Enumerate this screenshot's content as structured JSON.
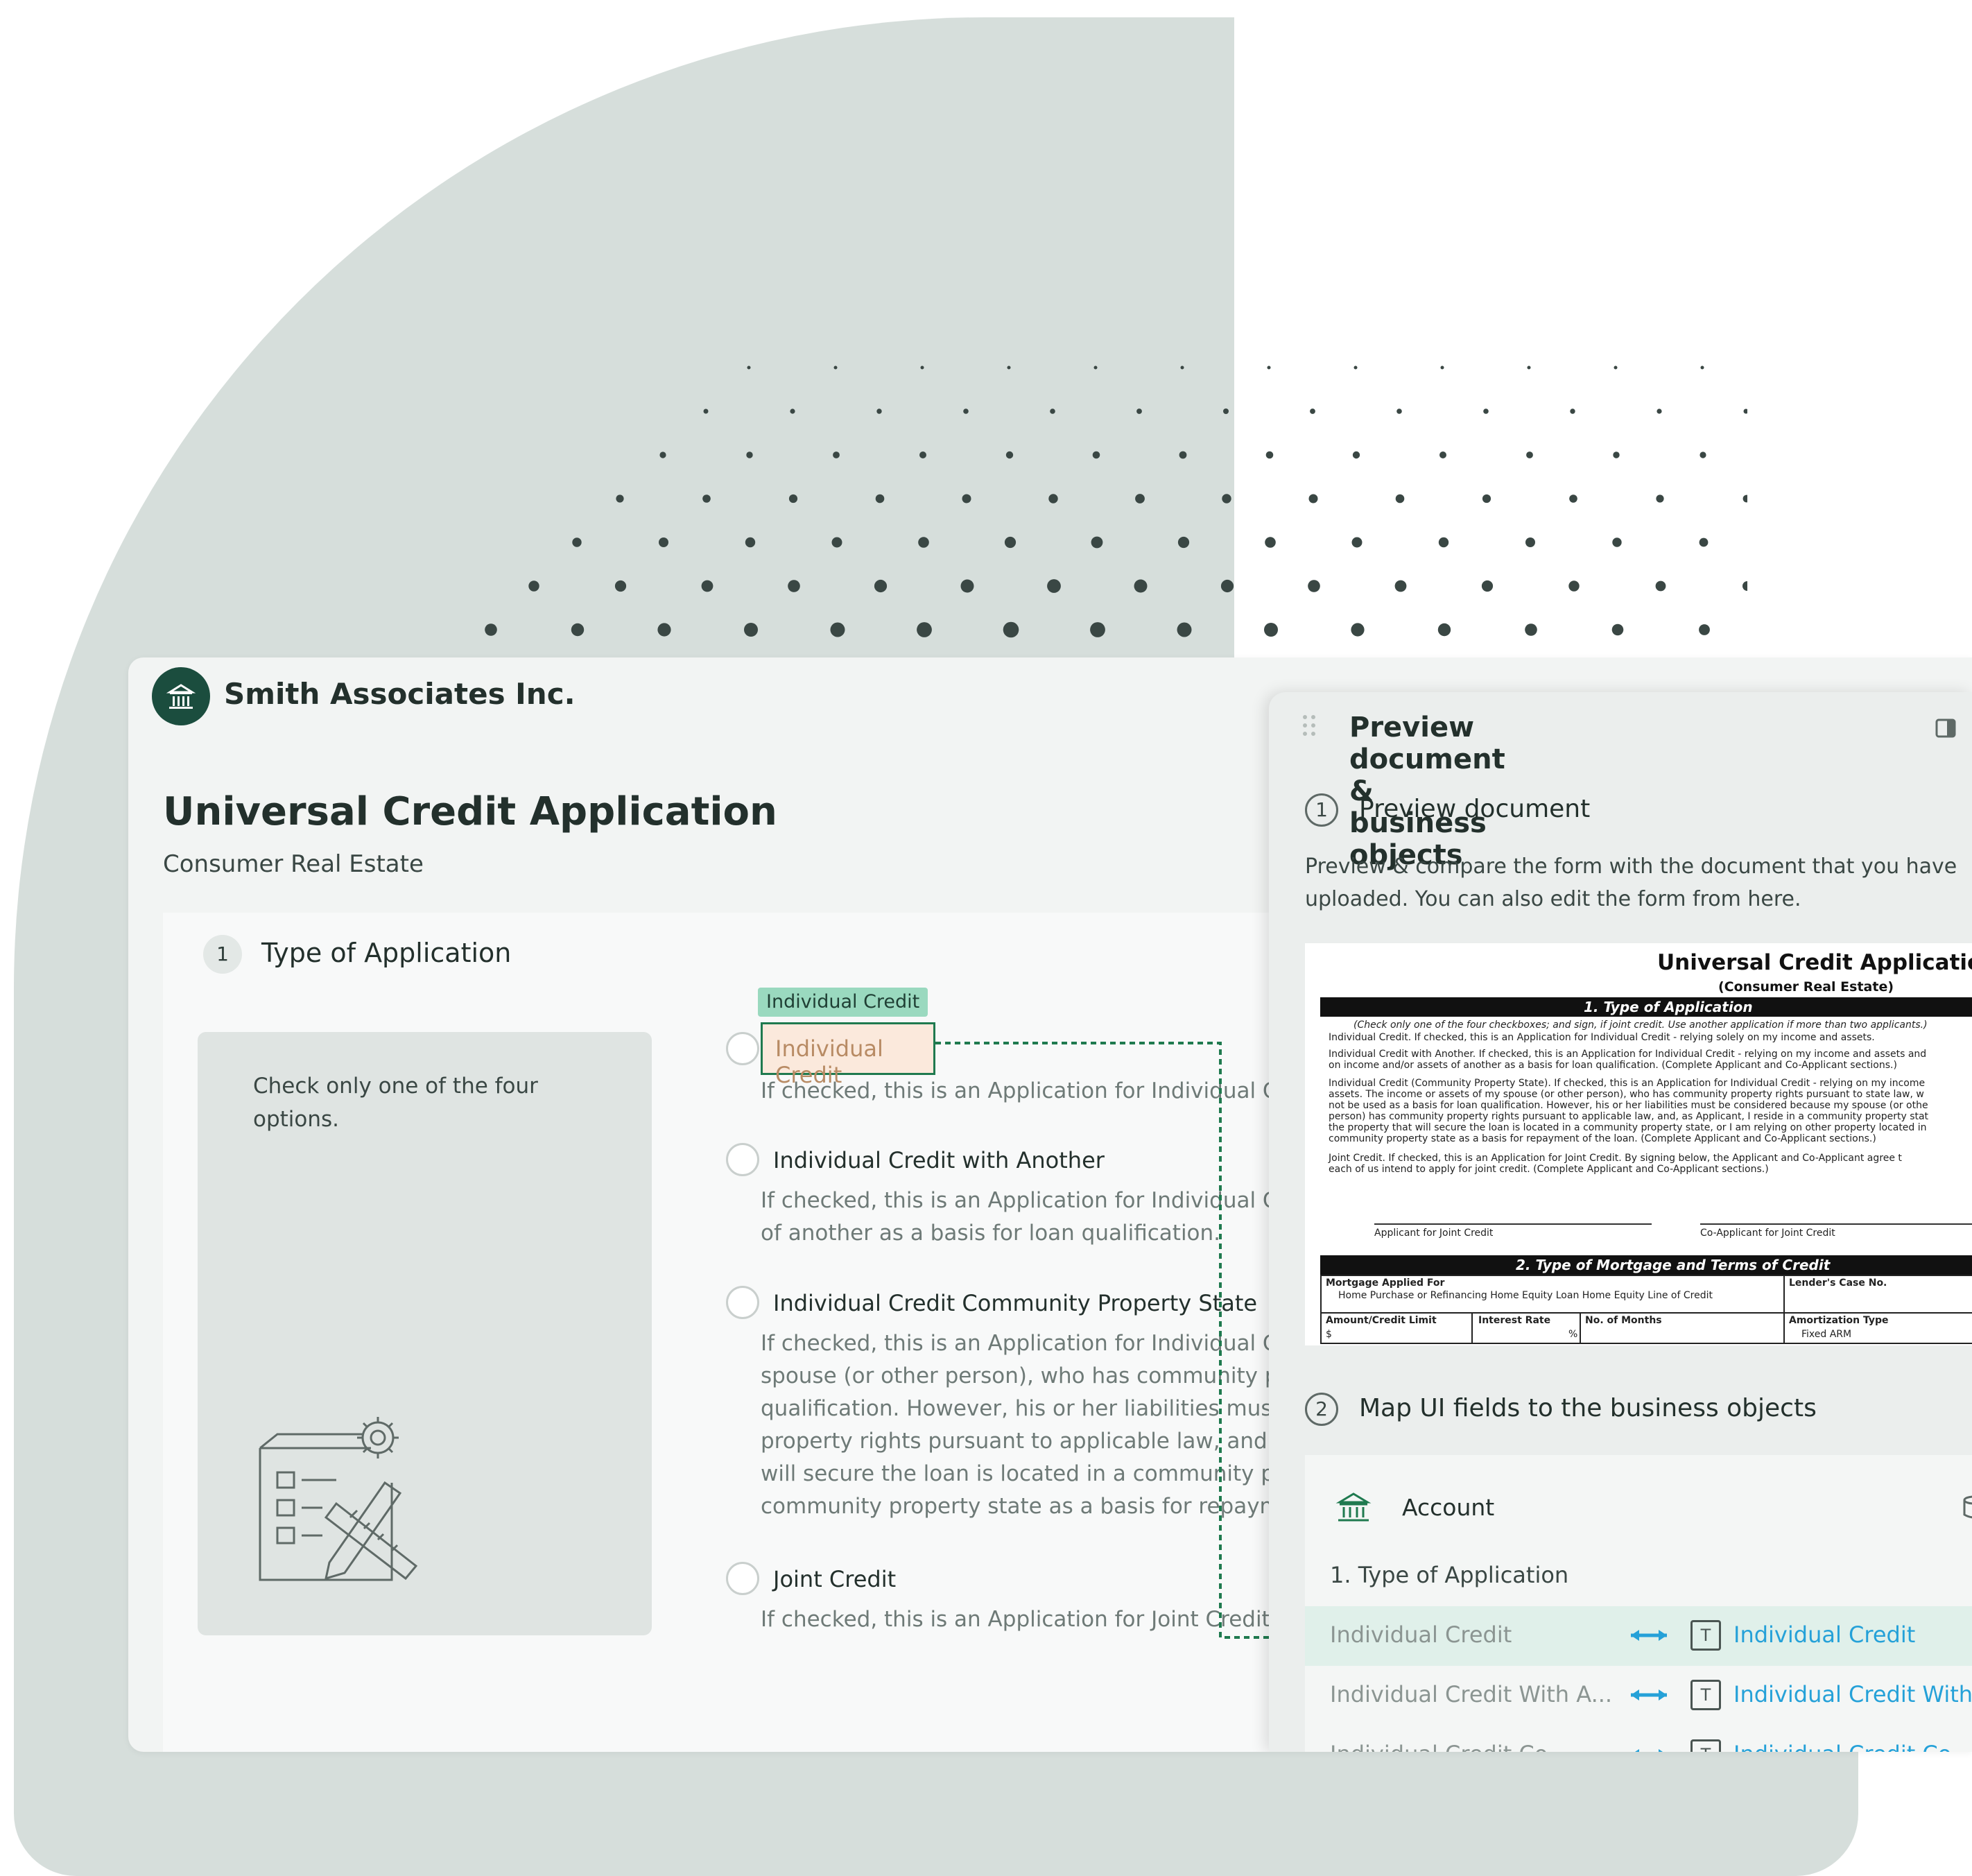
{
  "company": {
    "name": "Smith Associates Inc."
  },
  "form": {
    "title": "Universal Credit Application",
    "subtitle": "Consumer Real Estate",
    "section": {
      "number": "1",
      "title": "Type of Application"
    },
    "hint": "Check only one of the four options.",
    "highlight_tag": "Individual Credit",
    "options": [
      {
        "label": "Individual Credit",
        "desc": [
          "If checked, this is an Application for Individual C"
        ]
      },
      {
        "label": "Individual Credit with Another",
        "desc": [
          "If checked, this is an Application for Individual C",
          "of another as a basis for loan qualification."
        ]
      },
      {
        "label": "Individual Credit Community Property State",
        "desc": [
          "If checked, this is an Application for Individual C",
          "spouse (or other person), who has community pr",
          "qualification. However, his or her liabilities must",
          "property rights pursuant to applicable law, and,",
          "will secure the loan is located in a community pr",
          "community property state as a basis for repaym"
        ]
      },
      {
        "label": "Joint Credit",
        "desc": [
          "If checked, this is an Application for Joint Credit."
        ]
      }
    ]
  },
  "panel": {
    "title": "Preview document & business objects",
    "step1": {
      "number": "1",
      "title": "Preview document",
      "desc": "Preview & compare the form with the document that you have uploaded. You can also edit the form from here."
    },
    "doc": {
      "title": "Universal Credit Application",
      "subtitle": "(Consumer Real Estate)",
      "section1": "1. Type of Application",
      "instruction": "(Check only one of the four checkboxes; and sign, if joint credit. Use another application if more than two applicants.)",
      "lines": [
        "Individual Credit. If checked, this is an Application for Individual Credit - relying solely on my income and assets.",
        "Individual Credit with Another. If checked, this is an Application for Individual Credit - relying on my income and assets and",
        "on income and/or assets of another as a basis for loan qualification. (Complete Applicant and Co-Applicant sections.)",
        "Individual Credit (Community Property State). If checked, this is an Application for Individual Credit - relying on my income",
        "assets. The income or assets of my spouse (or other person), who has community property rights pursuant to state law, w",
        "not be used as a basis for loan qualification. However, his or her liabilities must be considered because my spouse (or othe",
        "person) has community property rights pursuant to applicable law, and, as Applicant, I reside in a community property stat",
        "the property that will secure the loan is located in a community property state, or I am relying on other property located in",
        "community property state as a basis for repayment of the loan. (Complete Applicant and Co-Applicant sections.)",
        "Joint Credit. If checked, this is an Application for Joint Credit. By signing below, the Applicant and Co-Applicant agree t",
        "each of us intend to apply for joint credit. (Complete Applicant and Co-Applicant sections.)"
      ],
      "sig1": "Applicant for Joint Credit",
      "sig2": "Co-Applicant for Joint Credit",
      "section2": "2. Type of Mortgage and Terms of Credit",
      "mortgage_label": "Mortgage Applied For",
      "mortgage_opts": "Home Purchase or Refinancing    Home Equity Loan    Home Equity Line of Credit",
      "lender": "Lender's Case No.",
      "amount": "Amount/Credit Limit",
      "amount_val": "$",
      "rate": "Interest Rate",
      "rate_val": "%",
      "months": "No. of Months",
      "amort": "Amortization Type",
      "amort_opts": "Fixed    ARM"
    },
    "step2": {
      "number": "2",
      "title": "Map UI fields to the business objects"
    },
    "mapping": {
      "object": "Account",
      "section": "1. Type of Application",
      "rows": [
        {
          "left": "Individual Credit",
          "type": "T",
          "right": "Individual Credit"
        },
        {
          "left": "Individual Credit With A...",
          "type": "T",
          "right": "Individual Credit With A"
        },
        {
          "left": "Individual Credit Co...",
          "type": "T",
          "right": "Individual Credit Co..."
        }
      ]
    }
  },
  "colors": {
    "brand": "#1b4d3e",
    "accent": "#1f7a4f",
    "link": "#25a1d8",
    "tag": "#9ad9bf"
  }
}
